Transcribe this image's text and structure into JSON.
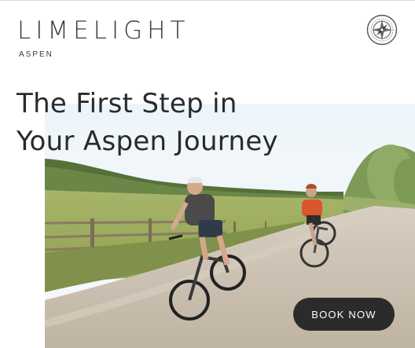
{
  "header": {
    "brand": "LIMELIGHT",
    "subbrand": "ASPEN",
    "menu_icon": "compass-icon"
  },
  "hero": {
    "headline_line1": "The First Step in",
    "headline_line2": "Your Aspen Journey",
    "image_subject": "two-cyclists-gravel-road-photo"
  },
  "cta": {
    "label": "BOOK NOW"
  },
  "colors": {
    "text": "#2b2b2b",
    "button_bg": "#2b2b2b",
    "button_text": "#ffffff",
    "background": "#ffffff"
  }
}
